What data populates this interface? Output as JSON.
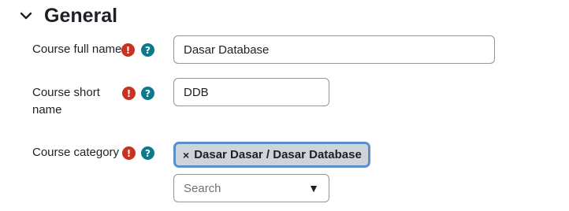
{
  "section": {
    "title": "General"
  },
  "fields": {
    "fullname": {
      "label": "Course full name",
      "value": "Dasar Database"
    },
    "shortname": {
      "label_line1": "Course short",
      "label_line2": "name",
      "value": "DDB"
    },
    "category": {
      "label": "Course category",
      "selected_tag": "Dasar Dasar / Dasar Database",
      "tag_remove": "×",
      "search_placeholder": "Search",
      "caret": "▼"
    }
  },
  "icons": {
    "required": "!",
    "help": "?",
    "required_name": "exclamation-icon",
    "help_name": "question-icon"
  },
  "colors": {
    "required": "#ca3120",
    "help": "#0b7a8c",
    "tag_bg": "#ced4da",
    "tag_border": "#5b8fc9"
  }
}
